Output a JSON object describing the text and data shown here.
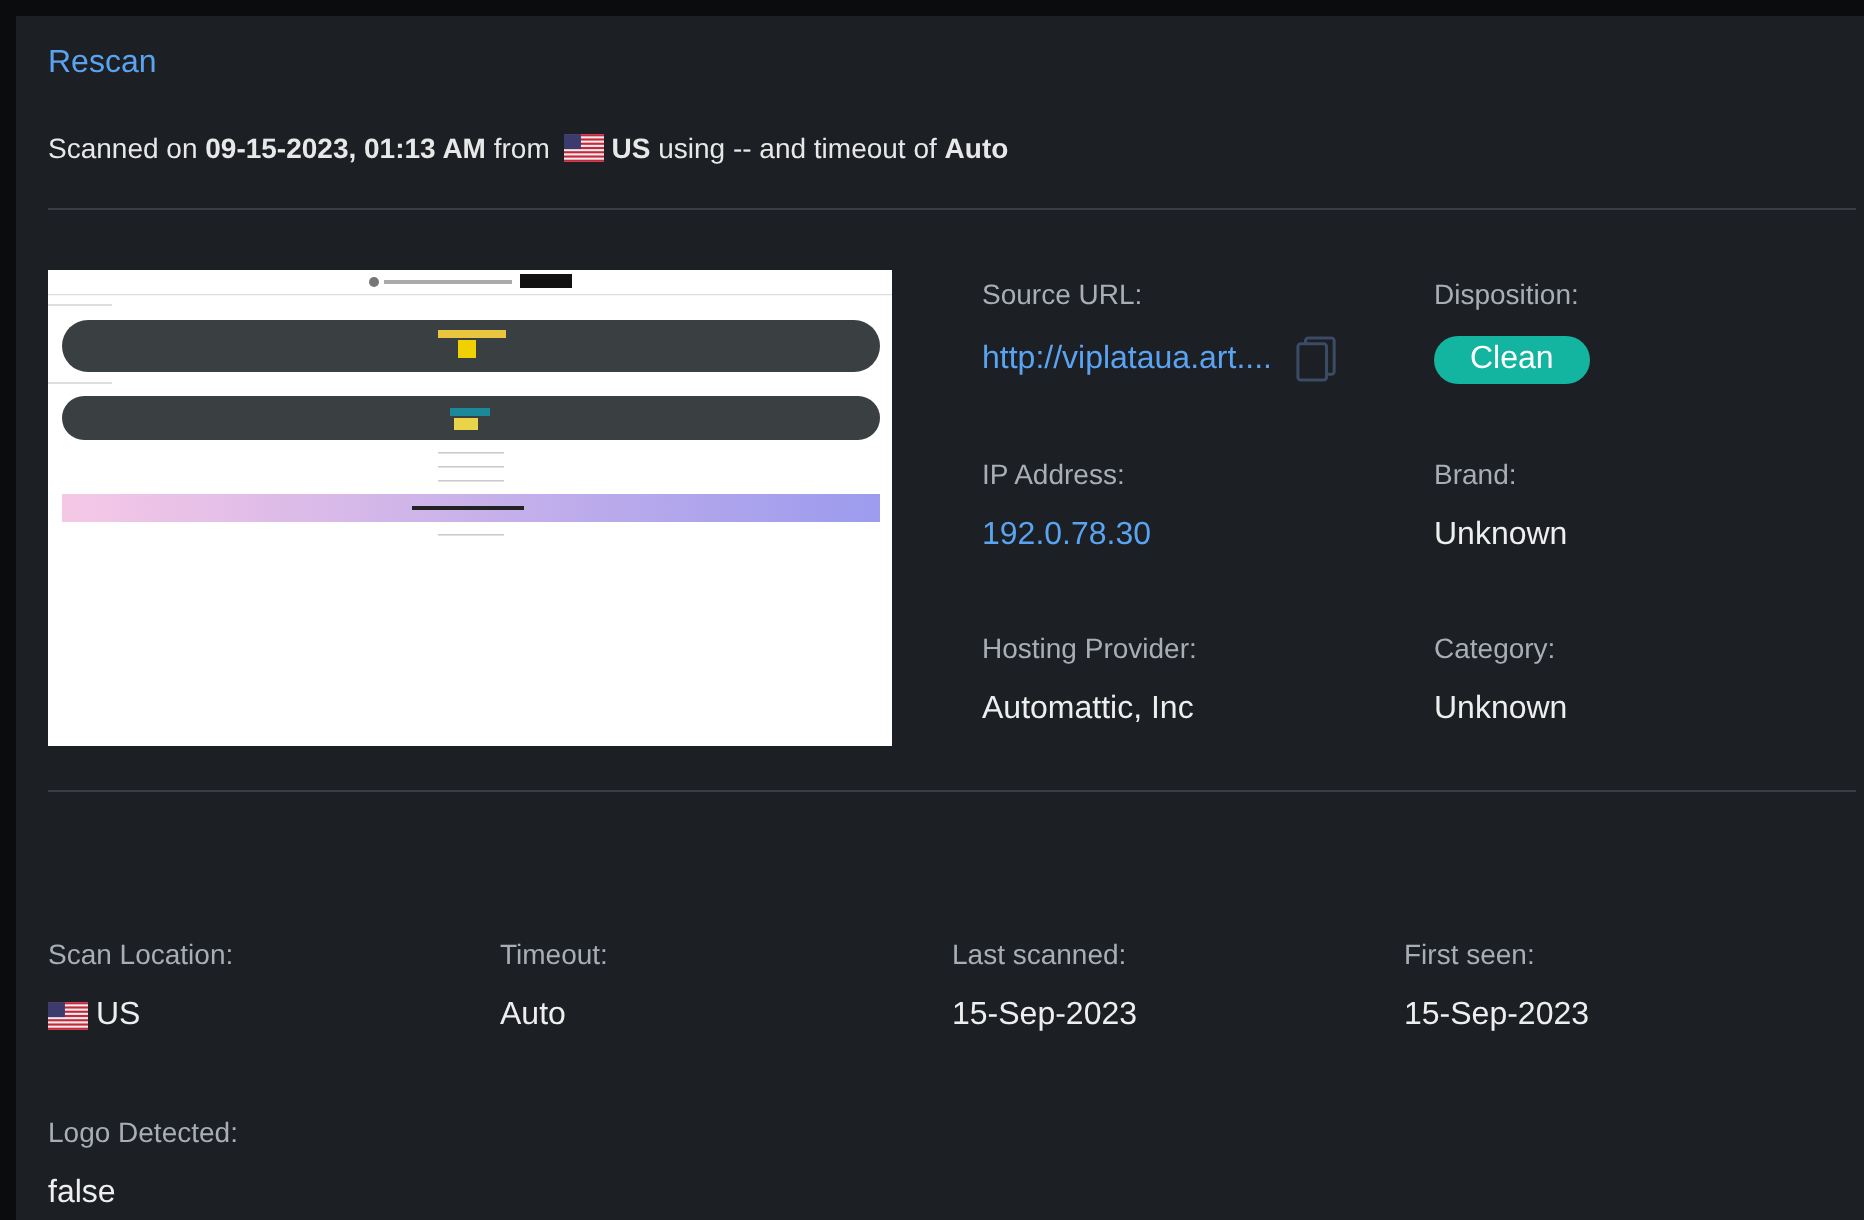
{
  "rescan": "Rescan",
  "scan_summary": {
    "prefix": "Scanned on ",
    "date": "09-15-2023, 01:13 AM",
    "from": " from ",
    "country": "US",
    "using": " using -- and timeout of ",
    "timeout": "Auto"
  },
  "screenshot": {
    "kind": "page-screenshot"
  },
  "details": [
    {
      "label": "Source URL:",
      "value": "http://viplataua.art....",
      "kind": "link-copy"
    },
    {
      "label": "Disposition:",
      "value": "Clean",
      "kind": "badge",
      "color": "#13b5a0"
    },
    {
      "label": "IP Address:",
      "value": "192.0.78.30",
      "kind": "link"
    },
    {
      "label": "Brand:",
      "value": "Unknown",
      "kind": "text"
    },
    {
      "label": "Hosting Provider:",
      "value": "Automattic, Inc",
      "kind": "text"
    },
    {
      "label": "Category:",
      "value": "Unknown",
      "kind": "text"
    }
  ],
  "scan_info": [
    {
      "label": "Scan Location:",
      "value": "US",
      "kind": "flag"
    },
    {
      "label": "Timeout:",
      "value": "Auto",
      "kind": "text"
    },
    {
      "label": "Last scanned:",
      "value": "15-Sep-2023",
      "kind": "text"
    },
    {
      "label": "First seen:",
      "value": "15-Sep-2023",
      "kind": "text"
    },
    {
      "label": "Logo Detected:",
      "value": "false",
      "kind": "text"
    }
  ]
}
